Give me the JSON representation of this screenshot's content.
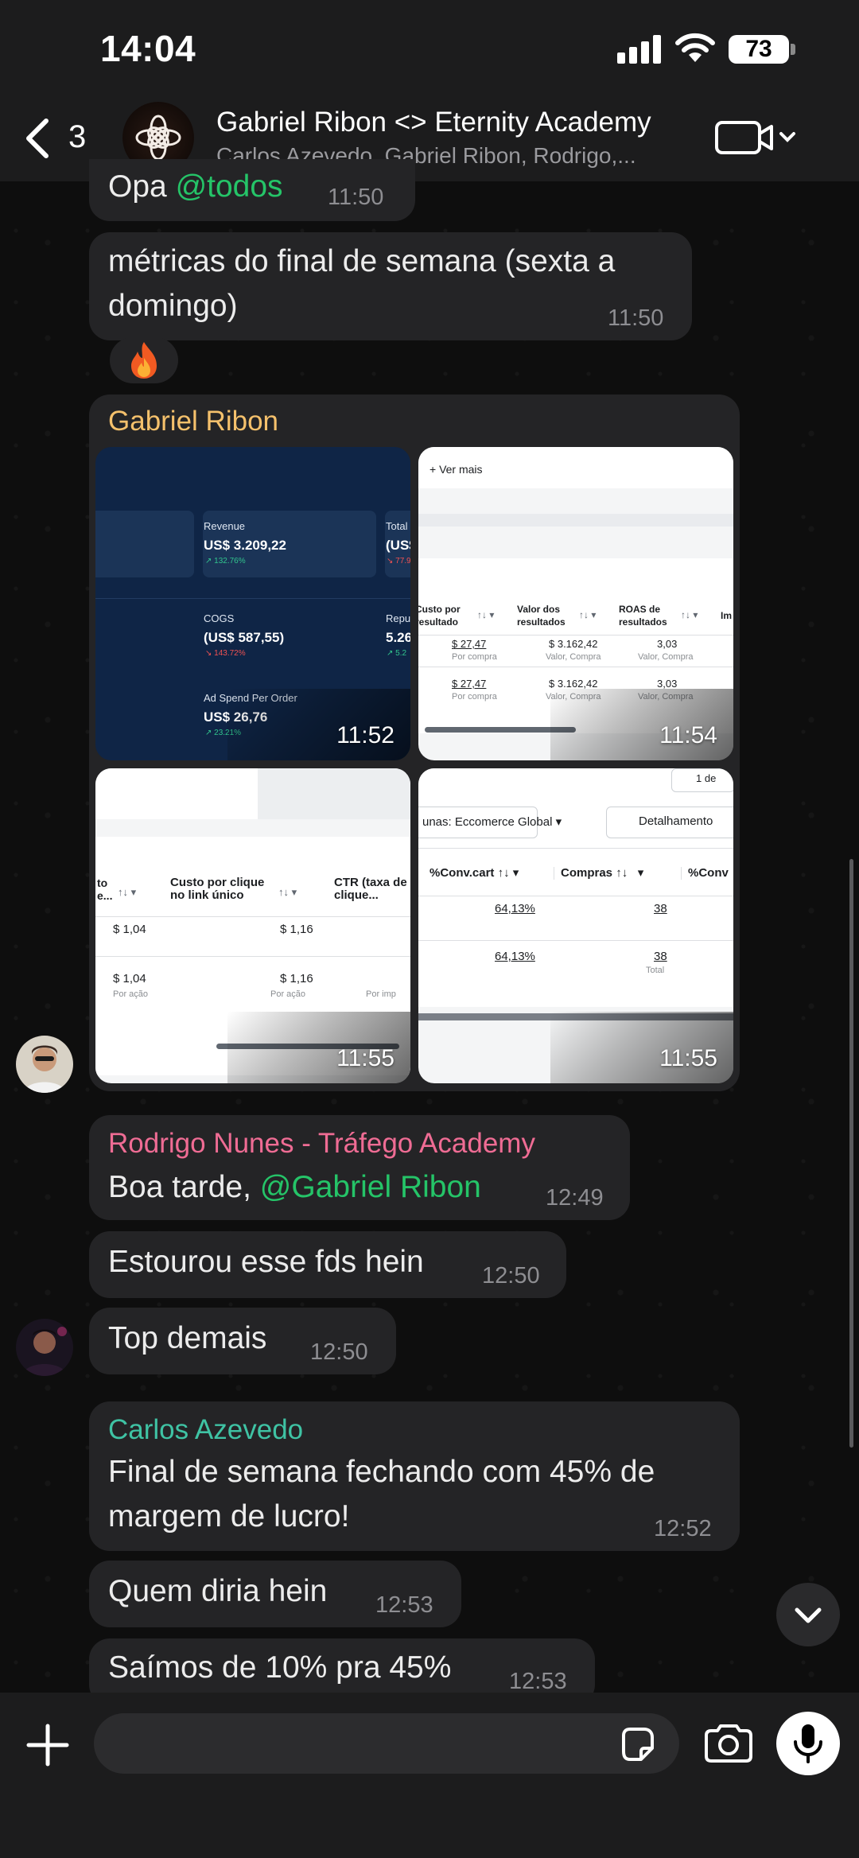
{
  "status_bar": {
    "time": "14:04",
    "battery": "73"
  },
  "header": {
    "back_count": "3",
    "title": "Gabriel Ribon <> Eternity Academy",
    "subtitle": "Carlos Azevedo, Gabriel Ribon, Rodrigo,..."
  },
  "messages": [
    {
      "prefix": "Opa ",
      "mention": "@todos",
      "time": "11:50"
    },
    {
      "line1": "métricas do final de semana (sexta a",
      "line2": "domingo)",
      "time": "11:50",
      "reaction": "🔥"
    },
    {
      "sender": "Gabriel Ribon",
      "sender_color": "#f5c16c"
    },
    {
      "sender": "Rodrigo Nunes - Tráfego Academy",
      "sender_color": "#ef6c94",
      "prefix": "Boa tarde, ",
      "mention": "@Gabriel Ribon",
      "time": "12:49"
    },
    {
      "text": "Estourou esse fds hein",
      "time": "12:50"
    },
    {
      "text": "Top demais",
      "time": "12:50"
    },
    {
      "sender": "Carlos Azevedo",
      "sender_color": "#3fc3a4",
      "line1": "Final de semana fechando com 45% de",
      "line2": "margem de lucro!",
      "time": "12:52"
    },
    {
      "text": "Quem diria hein",
      "time": "12:53"
    },
    {
      "text": "Saímos de 10% pra 45%",
      "time": "12:53"
    }
  ],
  "media": [
    {
      "time": "11:52",
      "labels": {
        "revenue": "Revenue",
        "revenue_value": "US$ 3.209,22",
        "revenue_change": "↗ 132.76%",
        "total": "Total (",
        "total_value": "(US$",
        "total_change": "↘ 77.9",
        "cogs": "COGS",
        "cogs_value": "(US$ 587,55)",
        "cogs_change": "↘ 143.72%",
        "repur": "Repur",
        "repur_value": "5.26",
        "repur_change": "↗ 5.2",
        "adspend": "Ad Spend Per Order",
        "adspend_value": "US$ 26,76",
        "adspend_change": "↗ 23.21%"
      }
    },
    {
      "time": "11:54",
      "labels": {
        "ver_mais": "+ Ver mais",
        "h1": "Custo por resultado",
        "h2": "Valor dos resultados",
        "h3": "ROAS de resultados",
        "h4": "Im",
        "c1": "$ 27,47",
        "c2": "$ 3.162,42",
        "c3": "3,03",
        "s1": "Por compra",
        "s2": "Valor, Compra",
        "s3": "Valor, Compra"
      }
    },
    {
      "time": "11:55",
      "labels": {
        "h1": "to e...",
        "h2": "Custo por clique no link único",
        "h3": "CTR (taxa de clique...",
        "c1": "$ 1,04",
        "c2": "$ 1,16",
        "s1": "Por ação",
        "s2": "Por ação",
        "s3": "Por imp"
      }
    },
    {
      "time": "11:55",
      "labels": {
        "date": "1 de",
        "dropdown": "unas: Eccomerce Global",
        "breakdown": "Detalhamento",
        "h1": "%Conv.cart",
        "h2": "Compras",
        "h3": "%Conv",
        "c1": "64,13%",
        "c2": "38",
        "total": "Total"
      }
    }
  ],
  "composer": {
    "placeholder": ""
  },
  "colors": {
    "bubble": "#242426",
    "mention": "#25c468",
    "bar": "#1c1c1d"
  }
}
